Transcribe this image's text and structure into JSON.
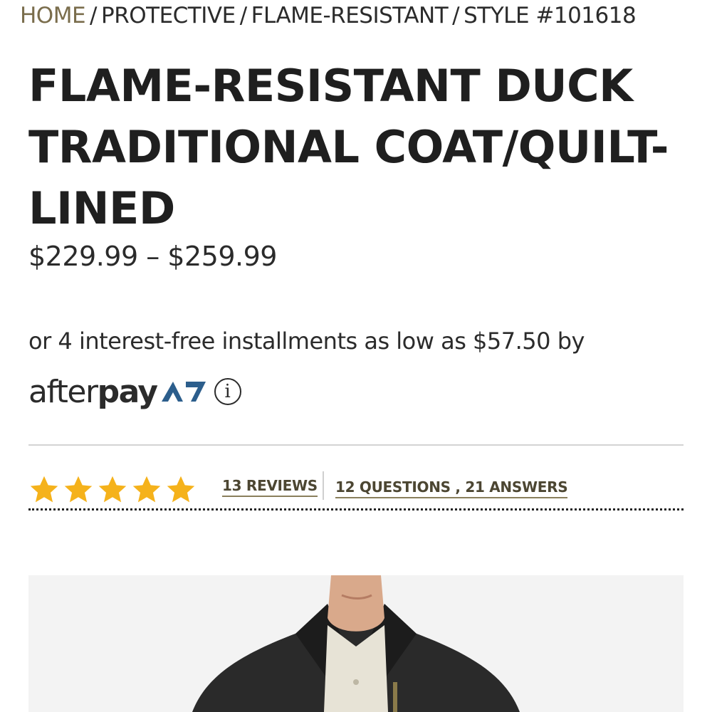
{
  "breadcrumb": {
    "home": "HOME",
    "separator": "/",
    "items": [
      "PROTECTIVE",
      "FLAME-RESISTANT",
      "STYLE #101618"
    ]
  },
  "product": {
    "title": "FLAME-RESISTANT DUCK TRADITIONAL COAT/QUILT-LINED",
    "price": "$229.99 – $259.99",
    "installments_text": "or 4 interest-free installments as low as $57.50 by",
    "afterpay": {
      "word_light": "after",
      "word_bold": "pay",
      "info_glyph": "i",
      "brand_color": "#2c5e8c"
    }
  },
  "rating": {
    "stars": 5,
    "star_color": "#f5b21b",
    "reviews_label": "13 REVIEWS",
    "qa_label": "12 QUESTIONS , 21 ANSWERS"
  },
  "colors": {
    "breadcrumb_home": "#7a6d4c",
    "link": "#4c4632",
    "link_underline": "#8a7f5c"
  }
}
